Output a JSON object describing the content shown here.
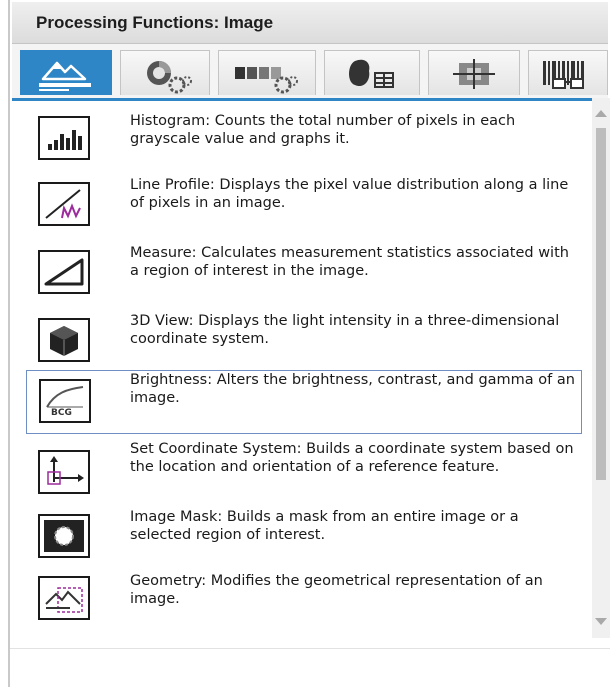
{
  "panel": {
    "title": "Processing Functions: Image"
  },
  "tabs": [
    {
      "icon": "image-landscape-icon",
      "active": true
    },
    {
      "icon": "color-gear-icon",
      "active": false
    },
    {
      "icon": "grayscale-gear-icon",
      "active": false
    },
    {
      "icon": "particle-table-icon",
      "active": false
    },
    {
      "icon": "pattern-crosshair-icon",
      "active": false
    },
    {
      "icon": "barcode-glasses-icon",
      "active": false
    }
  ],
  "functions": [
    {
      "name": "Histogram",
      "text": "Histogram:  Counts the total number of pixels in each grayscale value and graphs it.",
      "icon": "histogram-icon"
    },
    {
      "name": "Line Profile",
      "text": "Line Profile:  Displays the pixel value distribution along a line of pixels in an image.",
      "icon": "line-profile-icon"
    },
    {
      "name": "Measure",
      "text": "Measure:  Calculates measurement statistics associated with a region of interest in the image.",
      "icon": "measure-icon"
    },
    {
      "name": "3D View",
      "text": "3D View:  Displays the light intensity in a three-dimensional coordinate system.",
      "icon": "cube-icon"
    },
    {
      "name": "Brightness",
      "text": "Brightness:  Alters the brightness, contrast, and gamma of an image.",
      "icon": "bcg-curve-icon",
      "icon_text": "BCG",
      "selected": true
    },
    {
      "name": "Set Coordinate System",
      "text": "Set Coordinate System:  Builds a coordinate system based on the location and orientation of a reference feature.",
      "icon": "coordinate-system-icon"
    },
    {
      "name": "Image Mask",
      "text": "Image Mask:  Builds a mask from an entire image or a selected region of interest.",
      "icon": "image-mask-icon"
    },
    {
      "name": "Geometry",
      "text": "Geometry:  Modifies the geometrical representation of an image.",
      "icon": "geometry-icon"
    }
  ],
  "colors": {
    "accent": "#2e86c6",
    "selection_border": "#6f8ec4",
    "text": "#1a1a1a"
  }
}
